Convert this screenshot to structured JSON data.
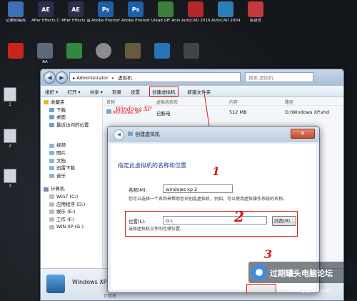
{
  "desktop": {
    "top_icons": [
      {
        "label": "迈腾创客网",
        "icon": "computer-icon",
        "color": "#3f6fb5",
        "glyph": ""
      },
      {
        "label": "After Effects CS4",
        "icon": "after-effects-icon",
        "color": "#2b2f4a",
        "glyph": "AE"
      },
      {
        "label": "After Effects 音频插件",
        "icon": "after-effects-icon",
        "color": "#2b2f4a",
        "glyph": "AE"
      },
      {
        "label": "Adobe Photosh...",
        "icon": "photoshop-icon",
        "color": "#1d5fa8",
        "glyph": "Ps"
      },
      {
        "label": "Adobe Photosh...",
        "icon": "photoshop-icon",
        "color": "#1d5fa8",
        "glyph": "Ps"
      },
      {
        "label": "Ulead GIF Animator 5",
        "icon": "gif-animator-icon",
        "color": "#3b7f3b",
        "glyph": ""
      },
      {
        "label": "AutoCAD 2010 - ...",
        "icon": "autocad-icon",
        "color": "#b3262a",
        "glyph": ""
      },
      {
        "label": "AutoCAD 2004 Chs",
        "icon": "autocad-icon",
        "color": "#2a7fb3",
        "glyph": ""
      },
      {
        "label": "易语言",
        "icon": "app-icon",
        "color": "#c23a3a",
        "glyph": ""
      }
    ],
    "row2_icons": [
      {
        "label": "",
        "icon": "app-icon",
        "color": "#c8261d"
      },
      {
        "label": "BA",
        "icon": "app-icon",
        "color": "#5b6a7d"
      },
      {
        "label": "",
        "icon": "app-icon",
        "color": "#33883f"
      },
      {
        "label": "",
        "icon": "disc-icon",
        "color": "#8c8c8c"
      },
      {
        "label": "",
        "icon": "tools-icon",
        "color": "#6a5a3d"
      },
      {
        "label": "",
        "icon": "app-icon",
        "color": "#2574b8"
      },
      {
        "label": "",
        "icon": "phone-icon",
        "color": "#444444"
      }
    ],
    "side_icons": [
      {
        "label": "1",
        "icon": "document-icon"
      },
      {
        "label": "2",
        "icon": "document-icon"
      },
      {
        "label": "3",
        "icon": "document-icon"
      }
    ]
  },
  "explorer": {
    "breadcrumb": [
      "Administrator",
      "虚拟机"
    ],
    "search_placeholder": "搜索 虚拟机",
    "toolbar": [
      "组织 ▾",
      "打开 ▾",
      "共享 ▾",
      "刻录",
      "设置",
      "创建虚拟机",
      "新建文件夹"
    ],
    "highlighted_toolbar_index": 5,
    "favorites_header": "收藏夹",
    "favorites": [
      "下载",
      "桌面",
      "最近访问的位置"
    ],
    "libraries": [
      "视频",
      "图片",
      "文档",
      "迅雷下载",
      "音乐"
    ],
    "computer_header": "计算机",
    "drives": [
      "Win7 (C:)",
      "应用程序 (D:)",
      "娱乐 (E:)",
      "工作 (F:)",
      "WIN XP (G:)"
    ],
    "columns": [
      "名称",
      "虚拟机状态",
      "内存",
      "路径"
    ],
    "rows": [
      {
        "name": "Windows XP",
        "state": "已断电",
        "memory": "512 MB",
        "path": "G:\\Windows XP.vhd"
      }
    ],
    "status_name": "Windows XP",
    "status_sub": "计算机"
  },
  "dialog": {
    "title": "创建虚拟机",
    "heading": "指定此虚拟机的名称和位置",
    "name_label": "名称(M):",
    "name_value": "windows xp 2",
    "name_help": "您可以选择一个名称来帮助您识别此虚拟机，例如，可以使用虚拟操作系统的名称。",
    "location_label": "位置(L):",
    "location_value": "G:\\",
    "browse_label": "浏览(R)...",
    "location_help": "选择虚拟机文件的存储位置。",
    "close_glyph": "✕"
  },
  "annotations": {
    "step1": "1",
    "step2": "2",
    "step3": "3",
    "red_label": "Windows XP",
    "color": "#e01717"
  },
  "watermark": {
    "text": "过期罐头电脑论坛",
    "site": "www.gggtpc.com"
  }
}
